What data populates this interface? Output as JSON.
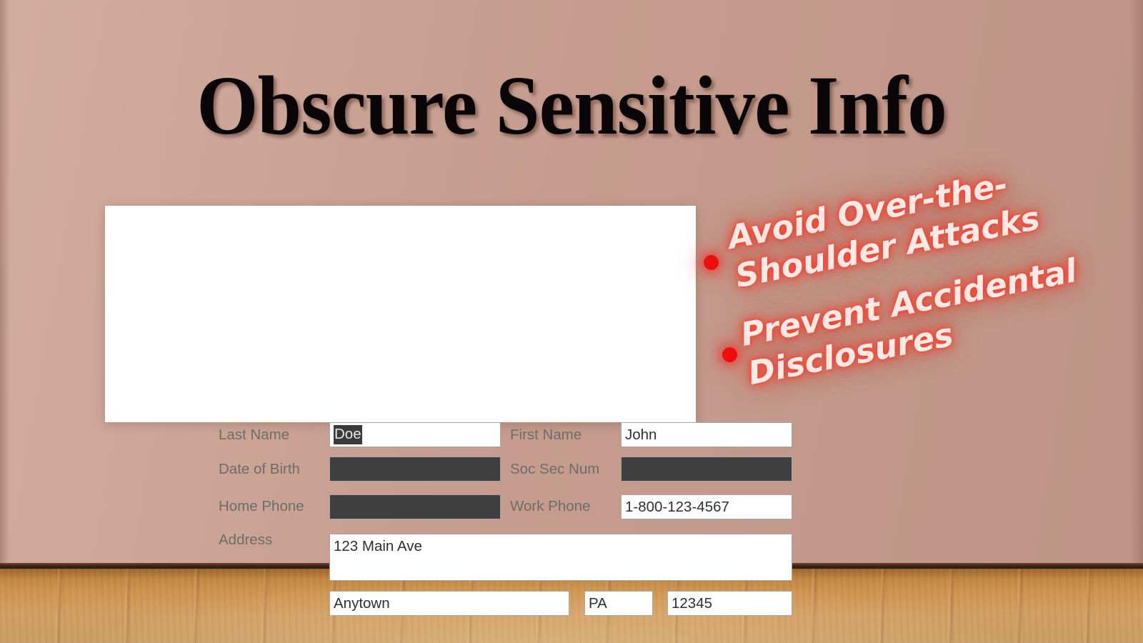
{
  "slide": {
    "title": "Obscure Sensitive Info",
    "wall_color": "#c59c8d",
    "floor_color": "#cf9551",
    "card_color": "#ffffff",
    "accent_color": "#ee1010",
    "redaction_color": "#3f3f3f"
  },
  "form": {
    "rows": [
      {
        "left_label": "Last Name",
        "left_value": "Doe",
        "left_redacted": false,
        "left_selected": true,
        "right_label": "First Name",
        "right_value": "John",
        "right_redacted": false
      },
      {
        "left_label": "Date of Birth",
        "left_value": "",
        "left_redacted": true,
        "left_selected": false,
        "right_label": "Soc Sec Num",
        "right_value": "",
        "right_redacted": true
      },
      {
        "left_label": "Home Phone",
        "left_value": "",
        "left_redacted": true,
        "left_selected": false,
        "right_label": "Work Phone",
        "right_value": "1-800-123-4567",
        "right_redacted": false
      }
    ],
    "address": {
      "label": "Address",
      "street": "123 Main Ave",
      "city": "Anytown",
      "state": "PA",
      "zip": "12345"
    }
  },
  "callout": {
    "bullets": [
      {
        "line1": "Avoid Over-the-",
        "line2": "Shoulder Attacks"
      },
      {
        "line1": "Prevent Accidental",
        "line2": "Disclosures"
      }
    ],
    "bullet_marker": "bullet-dot-icon"
  }
}
